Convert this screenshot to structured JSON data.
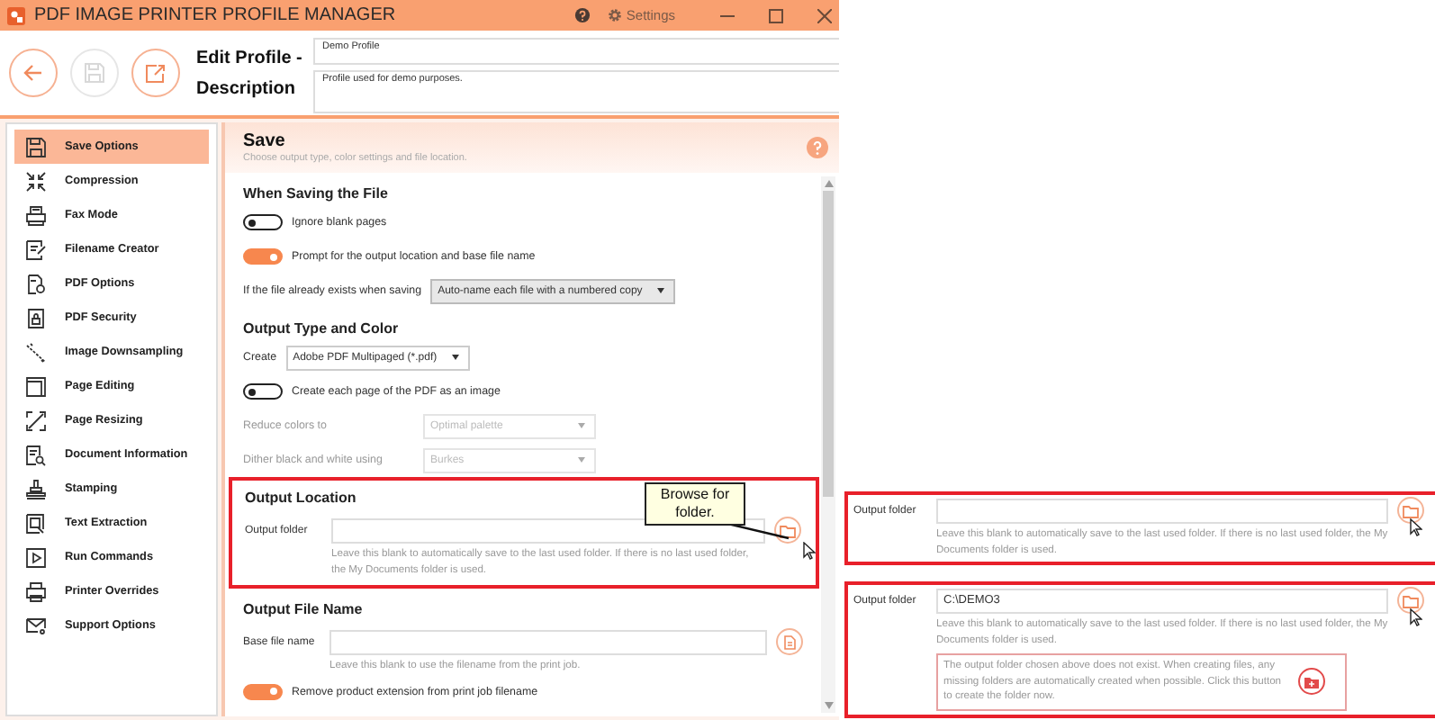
{
  "window": {
    "title": "PDF IMAGE PRINTER PROFILE MANAGER",
    "settings_label": "Settings"
  },
  "profile": {
    "name_label": "Edit Profile -",
    "name_value": "Demo Profile",
    "description_label": "Description",
    "description_value": "Profile used for demo purposes."
  },
  "header_buttons": [
    {
      "kind": "back",
      "disabled": false
    },
    {
      "kind": "save",
      "disabled": true
    },
    {
      "kind": "export",
      "disabled": false
    }
  ],
  "sidebar": {
    "items": [
      {
        "label": "Save Options",
        "selected": true
      },
      {
        "label": "Compression",
        "selected": false
      },
      {
        "label": "Fax Mode",
        "selected": false
      },
      {
        "label": "Filename Creator",
        "selected": false
      },
      {
        "label": "PDF Options",
        "selected": false
      },
      {
        "label": "PDF Security",
        "selected": false
      },
      {
        "label": "Image Downsampling",
        "selected": false
      },
      {
        "label": "Page Editing",
        "selected": false
      },
      {
        "label": "Page Resizing",
        "selected": false
      },
      {
        "label": "Document Information",
        "selected": false
      },
      {
        "label": "Stamping",
        "selected": false
      },
      {
        "label": "Text Extraction",
        "selected": false
      },
      {
        "label": "Run Commands",
        "selected": false
      },
      {
        "label": "Printer Overrides",
        "selected": false
      },
      {
        "label": "Support Options",
        "selected": false
      }
    ]
  },
  "panel": {
    "title": "Save",
    "subtitle": "Choose output type, color settings and file location.",
    "sections": [
      {
        "title": "When Saving the File",
        "highlighted": false,
        "rows": [
          {
            "kind": "toggle",
            "label": "Ignore blank pages",
            "on": false
          },
          {
            "kind": "toggle",
            "label": "Prompt for the output location and base file name",
            "on": true
          },
          {
            "kind": "select",
            "label": "If the file already exists when saving",
            "value": "Auto-name each file with a numbered copy",
            "disabled": false
          }
        ]
      },
      {
        "title": "Output Type and Color",
        "highlighted": false,
        "rows": [
          {
            "kind": "select",
            "label": "Create",
            "value": "Adobe PDF Multipaged (*.pdf)",
            "disabled": false
          },
          {
            "kind": "toggle",
            "label": "Create each page of the PDF as an image",
            "on": false
          },
          {
            "kind": "select",
            "label": "Reduce colors to",
            "value": "Optimal palette",
            "disabled": true
          },
          {
            "kind": "select",
            "label": "Dither black and white using",
            "value": "Burkes",
            "disabled": true
          }
        ]
      },
      {
        "title": "Output Location",
        "highlighted": true,
        "rows": [
          {
            "kind": "folder_path",
            "label": "Output folder",
            "hint": "Leave this blank to automatically save to the last used folder. If there is no last used folder, the My Documents folder is used."
          }
        ]
      },
      {
        "title": "Output File Name",
        "highlighted": false,
        "rows": [
          {
            "kind": "file_path",
            "label": "Base file name",
            "hint": "Leave this blank to use the filename from the print job."
          },
          {
            "kind": "toggle",
            "label": "Remove product extension from print job filename",
            "on": true
          }
        ]
      }
    ]
  },
  "tooltip": {
    "text": "Browse for folder."
  },
  "insets": [
    {
      "label": "Output folder",
      "hint": "Leave this blank to automatically save to the last used folder. If there is no last used folder, the My Documents folder is used."
    },
    {
      "label": "Output folder",
      "value": "C:\\DEMO3",
      "hint": "Leave this blank to automatically save to the last used folder. If there is no last used folder, the My Documents folder is used.",
      "warning": "The output folder chosen above does not exist. When creating files, any missing folders are automatically created when possible. Click this button to create the folder now."
    }
  ]
}
